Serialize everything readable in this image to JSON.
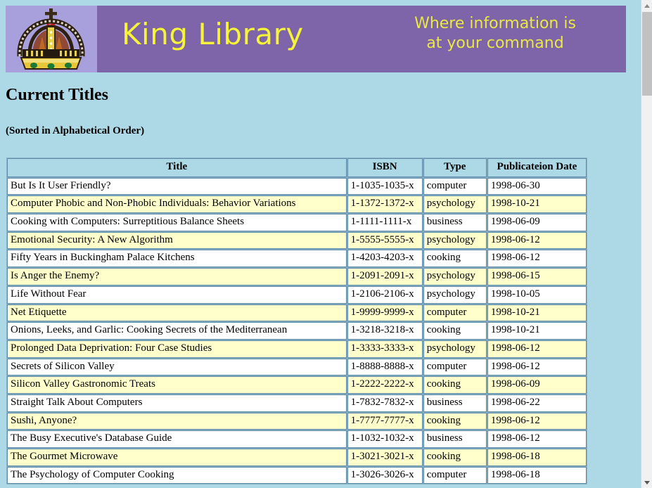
{
  "window": {
    "background_color": "#ADD8E6"
  },
  "banner": {
    "background_color": "#7E64A8",
    "logo_background_color": "#A8A0DC",
    "logo_icon": "crown-icon",
    "brand_title": "King Library",
    "brand_text_color": "#F5F33C",
    "tagline_line1": "Where information is",
    "tagline_line2": "at your command"
  },
  "headings": {
    "page_title": "Current Titles",
    "subtitle": "(Sorted in Alphabetical Order)"
  },
  "table": {
    "header_background_color": "#ADD8E6",
    "row_white_color": "#FFFFFF",
    "row_cream_color": "#FFFFCC",
    "border_color": "#5E8CA8",
    "columns": [
      "Title",
      "ISBN",
      "Type",
      "Publicateion Date"
    ],
    "rows": [
      {
        "title": "But Is It User Friendly?",
        "isbn": "1-1035-1035-x",
        "type": "computer",
        "date": "1998-06-30",
        "shade": "white"
      },
      {
        "title": "Computer Phobic and Non-Phobic Individuals: Behavior Variations",
        "isbn": "1-1372-1372-x",
        "type": "psychology",
        "date": "1998-10-21",
        "shade": "cream"
      },
      {
        "title": "Cooking with Computers: Surreptitious Balance Sheets",
        "isbn": "1-1111-1111-x",
        "type": "business",
        "date": "1998-06-09",
        "shade": "white"
      },
      {
        "title": "Emotional Security: A New Algorithm",
        "isbn": "1-5555-5555-x",
        "type": "psychology",
        "date": "1998-06-12",
        "shade": "cream"
      },
      {
        "title": "Fifty Years in Buckingham Palace Kitchens",
        "isbn": "1-4203-4203-x",
        "type": "cooking",
        "date": "1998-06-12",
        "shade": "white"
      },
      {
        "title": "Is Anger the Enemy?",
        "isbn": "1-2091-2091-x",
        "type": "psychology",
        "date": "1998-06-15",
        "shade": "cream"
      },
      {
        "title": "Life Without Fear",
        "isbn": "1-2106-2106-x",
        "type": "psychology",
        "date": "1998-10-05",
        "shade": "white"
      },
      {
        "title": "Net Etiquette",
        "isbn": "1-9999-9999-x",
        "type": "computer",
        "date": "1998-10-21",
        "shade": "cream"
      },
      {
        "title": "Onions, Leeks, and Garlic: Cooking Secrets of the Mediterranean",
        "isbn": "1-3218-3218-x",
        "type": "cooking",
        "date": "1998-10-21",
        "shade": "white"
      },
      {
        "title": "Prolonged Data Deprivation: Four Case Studies",
        "isbn": "1-3333-3333-x",
        "type": "psychology",
        "date": "1998-06-12",
        "shade": "cream"
      },
      {
        "title": "Secrets of Silicon Valley",
        "isbn": "1-8888-8888-x",
        "type": "computer",
        "date": "1998-06-12",
        "shade": "white"
      },
      {
        "title": "Silicon Valley Gastronomic Treats",
        "isbn": "1-2222-2222-x",
        "type": "cooking",
        "date": "1998-06-09",
        "shade": "cream"
      },
      {
        "title": "Straight Talk About Computers",
        "isbn": "1-7832-7832-x",
        "type": "business",
        "date": "1998-06-22",
        "shade": "white"
      },
      {
        "title": "Sushi, Anyone?",
        "isbn": "1-7777-7777-x",
        "type": "cooking",
        "date": "1998-06-12",
        "shade": "cream"
      },
      {
        "title": "The Busy Executive's Database Guide",
        "isbn": "1-1032-1032-x",
        "type": "business",
        "date": "1998-06-12",
        "shade": "white"
      },
      {
        "title": "The Gourmet Microwave",
        "isbn": "1-3021-3021-x",
        "type": "cooking",
        "date": "1998-06-18",
        "shade": "cream"
      },
      {
        "title": "The Psychology of Computer Cooking",
        "isbn": "1-3026-3026-x",
        "type": "computer",
        "date": "1998-06-18",
        "shade": "white"
      }
    ]
  },
  "scrollbar": {
    "up_arrow": "scroll-up-arrow",
    "down_arrow": "scroll-down-arrow"
  }
}
